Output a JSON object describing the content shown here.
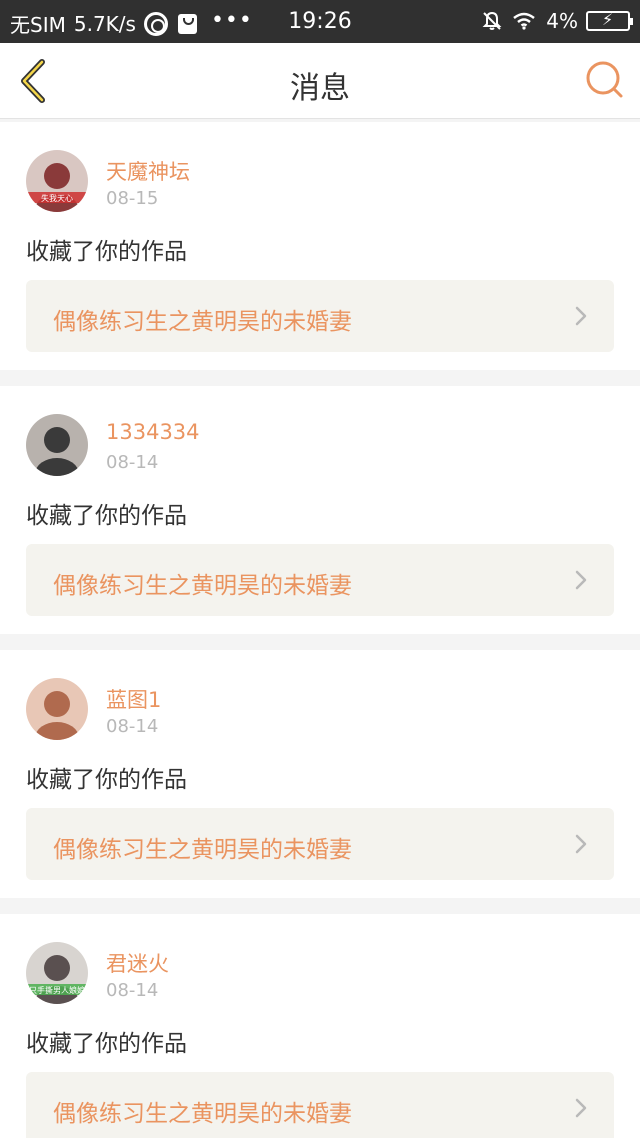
{
  "status_bar": {
    "carrier": "无SIM",
    "speed": "5.7K/s",
    "dots": "•••",
    "time": "19:26",
    "battery": "4%"
  },
  "header": {
    "title": "消息",
    "accent_color": "#ea9460",
    "back_icon": "chevron-left-icon",
    "search_icon": "search-icon"
  },
  "messages": [
    {
      "username": "天魔神坛",
      "date": "08-15",
      "action": "收藏了你的作品",
      "work_title": "偶像练习生之黄明昊的未婚妻",
      "avatar_text": "失我天心",
      "avatar_colors": [
        "#d9c7c2",
        "#8a3a3a",
        "#cc3030"
      ]
    },
    {
      "username": "1334334",
      "date": "08-14",
      "action": "收藏了你的作品",
      "work_title": "偶像练习生之黄明昊的未婚妻",
      "avatar_text": "",
      "avatar_colors": [
        "#b8b2ad",
        "#3a3a3a",
        "#6b5a50"
      ]
    },
    {
      "username": "蓝图1",
      "date": "08-14",
      "action": "收藏了你的作品",
      "work_title": "偶像练习生之黄明昊的未婚妻",
      "avatar_text": "",
      "avatar_colors": [
        "#e8c7b6",
        "#b06a4e",
        "#6e8a5a"
      ]
    },
    {
      "username": "君迷火",
      "date": "08-14",
      "action": "收藏了你的作品",
      "work_title": "偶像练习生之黄明昊的未婚妻",
      "avatar_text": "只手撕男人娘娘",
      "avatar_colors": [
        "#d8d4d0",
        "#5a5050",
        "#4caf50"
      ]
    }
  ]
}
